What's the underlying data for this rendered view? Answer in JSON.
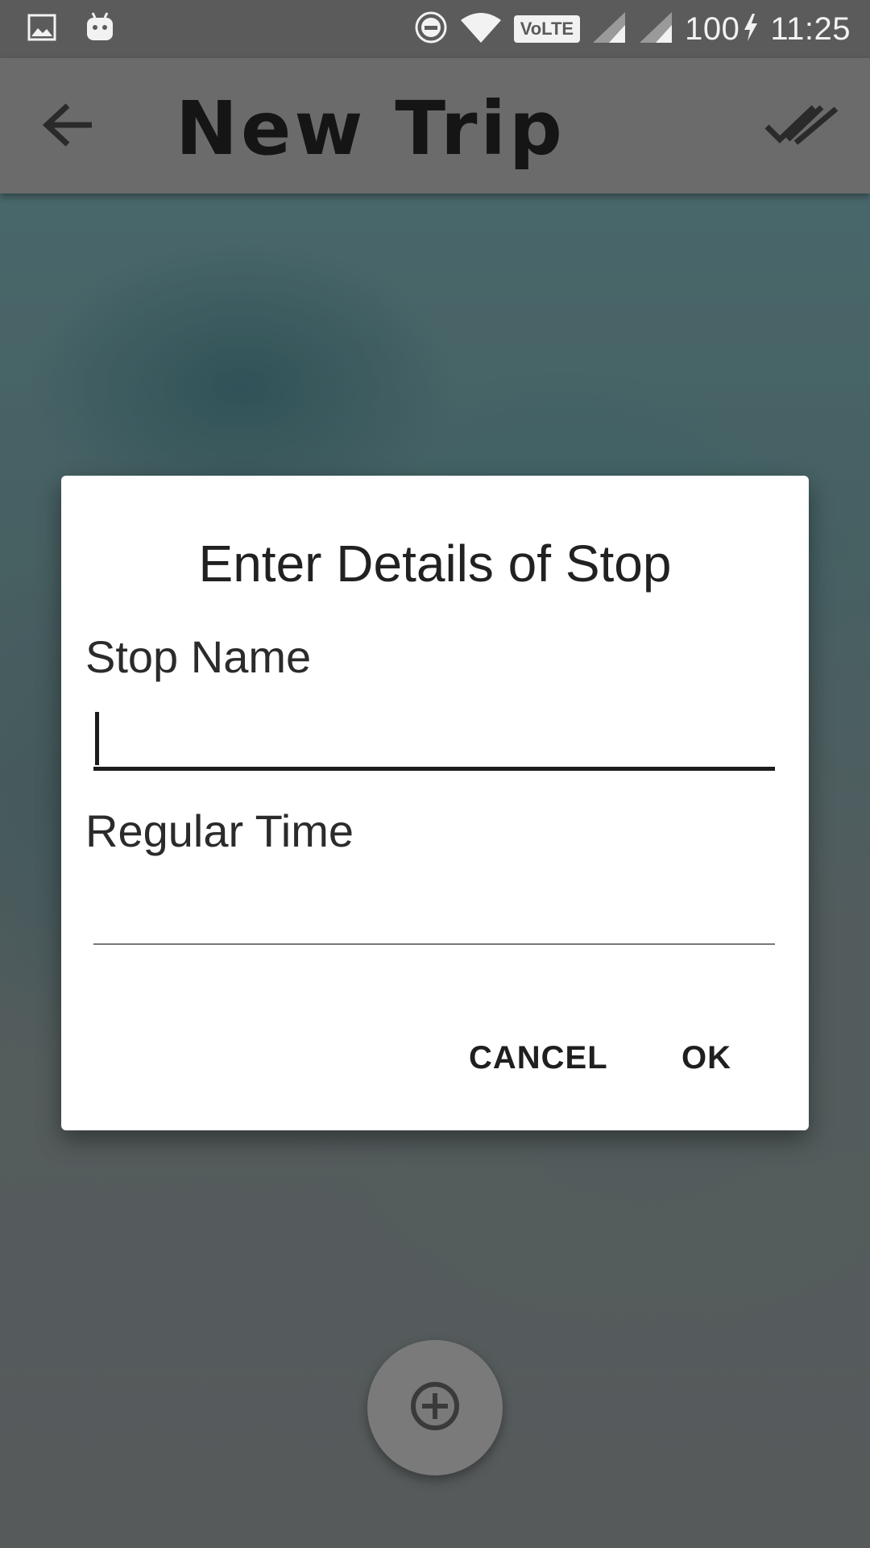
{
  "status_bar": {
    "battery": "100",
    "time": "11:25",
    "network_badge": "VoLTE",
    "icons": [
      "image-icon",
      "android-icon",
      "do-not-disturb-icon",
      "wifi-icon",
      "signal-icon",
      "signal-icon",
      "charging-icon"
    ]
  },
  "app_bar": {
    "title": "New Trip",
    "back_icon": "arrow-back-icon",
    "done_icon": "done-all-icon"
  },
  "dialog": {
    "title": "Enter Details of Stop",
    "stop_name_label": "Stop Name",
    "stop_name_value": "",
    "regular_time_label": "Regular Time",
    "regular_time_value": "",
    "cancel_label": "CANCEL",
    "ok_label": "OK"
  },
  "fab": {
    "icon": "add-circle-icon"
  },
  "colors": {
    "status_bar": "#5b5b5b",
    "app_bar": "#6b6b6b",
    "dialog_bg": "#ffffff",
    "text_dark": "#212121"
  }
}
